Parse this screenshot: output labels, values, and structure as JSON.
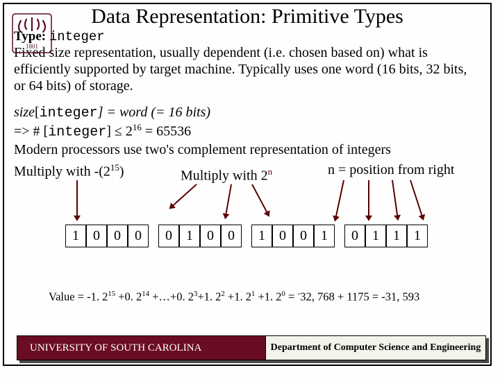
{
  "title": "Data Representation: Primitive Types",
  "type_label": "Type:",
  "type_name": "integer",
  "paragraph": "Fixed size representation, usually dependent (i.e. chosen based on) what is efficiently supported by target machine. Typically uses one word (16 bits, 32 bits, or 64 bits) of storage.",
  "sizeline": {
    "a_it": "size",
    "a_br": "[",
    "a_mono": "integer",
    "a_rest": "] = word (= 16 bits)",
    "b_pre": "=> # [",
    "b_mono": "integer",
    "b_mid": "] ≤ 2",
    "b_sup": "16",
    "b_post": " = 65536"
  },
  "line_mod": "Modern processors use two's complement representation of integers",
  "ann_left_pre": "Multiply with -(2",
  "ann_left_sup": "15",
  "ann_left_post": ")",
  "ann_mid_pre": "Multiply with 2",
  "ann_mid_supn": "n",
  "ann_right": "n = position from right",
  "bits": [
    "1",
    "0",
    "0",
    "0",
    "0",
    "1",
    "0",
    "0",
    "1",
    "0",
    "0",
    "1",
    "0",
    "1",
    "1",
    "1"
  ],
  "value_pre": "Value = -1. 2",
  "value_terms": [
    {
      "s": "15",
      "t": " +0. 2"
    },
    {
      "s": "14",
      "t": " +…+0. 2"
    },
    {
      "s": "3",
      "t": "+1. 2"
    },
    {
      "s": "2",
      "t": " +1. 2"
    },
    {
      "s": "1",
      "t": " +1. 2"
    },
    {
      "s": "0",
      "t": " = "
    }
  ],
  "value_tail_a": "-",
  "value_tail_b": "32, 768 + 1175 = -31, 593",
  "footer_left": "UNIVERSITY OF SOUTH CAROLINA",
  "footer_right": "Department of Computer Science and Engineering"
}
